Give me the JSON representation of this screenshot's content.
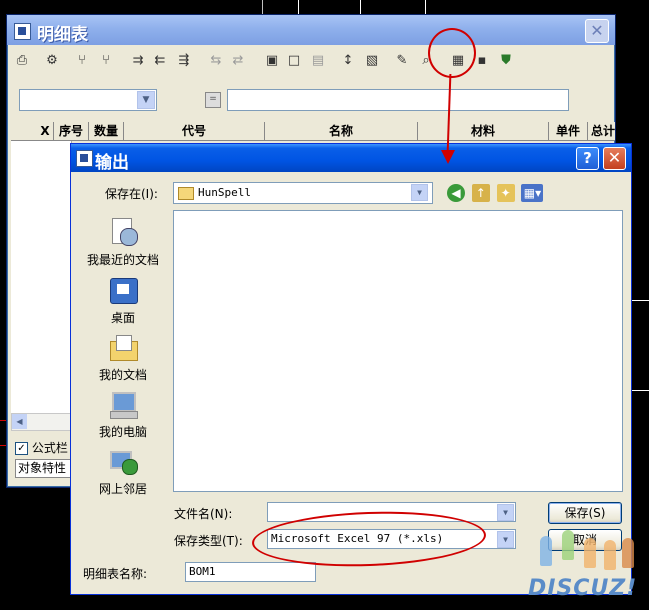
{
  "main_window": {
    "title": "明细表",
    "close_label": "✕",
    "toolbar_icons": [
      "printer-icon",
      "settings-icon",
      "fork-icon",
      "fork2-icon",
      "join-icon",
      "split-icon",
      "merge-icon",
      "align-icon",
      "align2-icon",
      "properties-icon",
      "layout-icon",
      "sort-icon",
      "report-icon",
      "tool-icon",
      "search-icon",
      "export-excel-icon",
      "save-icon",
      "shield-icon"
    ],
    "columns": [
      "X",
      "序号",
      "数量",
      "代号",
      "名称",
      "材料",
      "单件",
      "总计"
    ],
    "checkbox_label": "公式栏",
    "checkbox_checked": true,
    "object_property_label": "对象特性",
    "filter_button_label": "="
  },
  "dialog": {
    "title": "输出",
    "help_label": "?",
    "close_label": "✕",
    "look_in_label": "保存在(I):",
    "look_in_value": "HunSpell",
    "places": [
      {
        "name": "recent-documents",
        "label": "我最近的文档"
      },
      {
        "name": "desktop",
        "label": "桌面"
      },
      {
        "name": "my-documents",
        "label": "我的文档"
      },
      {
        "name": "my-computer",
        "label": "我的电脑"
      },
      {
        "name": "network-places",
        "label": "网上邻居"
      }
    ],
    "filename_label": "文件名(N):",
    "filename_value": "",
    "filetype_label": "保存类型(T):",
    "filetype_value": "Microsoft Excel 97 (*.xls)",
    "save_button": "保存(S)",
    "cancel_button": "取消",
    "bom_name_label": "明细表名称:",
    "bom_name_value": "BOM1"
  },
  "watermark": {
    "text": "DISCUZ!"
  },
  "colors": {
    "annotation_red": "#d00000",
    "xp_blue": "#0054e3",
    "dialog_bg": "#ece9d8"
  }
}
